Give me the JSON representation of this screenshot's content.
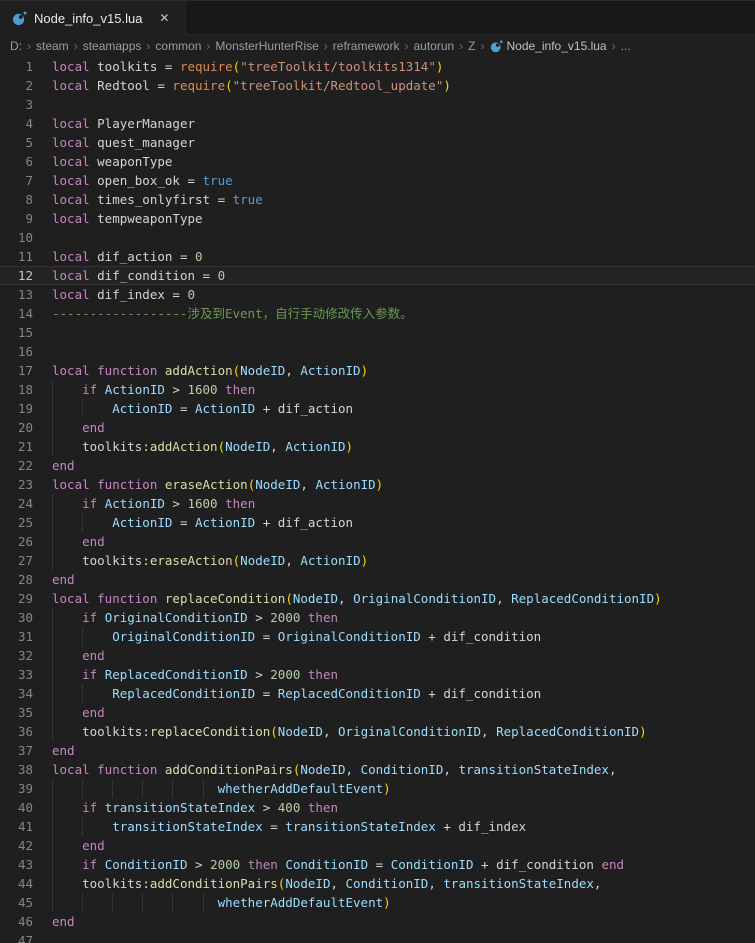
{
  "tab": {
    "title": "Node_info_v15.lua",
    "close_glyph": "✕"
  },
  "breadcrumb": {
    "items": [
      "D:",
      "steam",
      "steamapps",
      "common",
      "MonsterHunterRise",
      "reframework",
      "autorun",
      "Z"
    ],
    "file": "Node_info_v15.lua",
    "trailing": "...",
    "separator": "›"
  },
  "colors": {
    "tokens": {
      "kw": "#C586C0",
      "fn": "#DCDCAA",
      "rq": "#D98C54",
      "v": "#D4D4D4",
      "p": "#9CDCFE",
      "op": "#D4D4D4",
      "b": "#FFD700",
      "s": "#CE9178",
      "n": "#B5CEA8",
      "bo": "#569CD6",
      "cm": "#6A9955"
    },
    "accent_file_icon": "#4d9fd1"
  },
  "editor": {
    "language": "lua",
    "current_line": 12,
    "lines": [
      {
        "n": 1,
        "g": [],
        "t": [
          [
            "kw",
            "local "
          ],
          [
            "v",
            "toolkits"
          ],
          [
            "op",
            " = "
          ],
          [
            "rq",
            "require"
          ],
          [
            "b",
            "("
          ],
          [
            "s",
            "\"treeToolkit/toolkits1314\""
          ],
          [
            "b",
            ")"
          ]
        ]
      },
      {
        "n": 2,
        "g": [],
        "t": [
          [
            "kw",
            "local "
          ],
          [
            "v",
            "Redtool"
          ],
          [
            "op",
            " = "
          ],
          [
            "rq",
            "require"
          ],
          [
            "b",
            "("
          ],
          [
            "s",
            "\"treeToolkit/Redtool_update\""
          ],
          [
            "b",
            ")"
          ]
        ]
      },
      {
        "n": 3,
        "g": [],
        "t": []
      },
      {
        "n": 4,
        "g": [],
        "t": [
          [
            "kw",
            "local "
          ],
          [
            "v",
            "PlayerManager"
          ]
        ]
      },
      {
        "n": 5,
        "g": [],
        "t": [
          [
            "kw",
            "local "
          ],
          [
            "v",
            "quest_manager"
          ]
        ]
      },
      {
        "n": 6,
        "g": [],
        "t": [
          [
            "kw",
            "local "
          ],
          [
            "v",
            "weaponType"
          ]
        ]
      },
      {
        "n": 7,
        "g": [],
        "t": [
          [
            "kw",
            "local "
          ],
          [
            "v",
            "open_box_ok"
          ],
          [
            "op",
            " = "
          ],
          [
            "bo",
            "true"
          ]
        ]
      },
      {
        "n": 8,
        "g": [],
        "t": [
          [
            "kw",
            "local "
          ],
          [
            "v",
            "times_onlyfirst"
          ],
          [
            "op",
            " = "
          ],
          [
            "bo",
            "true"
          ]
        ]
      },
      {
        "n": 9,
        "g": [],
        "t": [
          [
            "kw",
            "local "
          ],
          [
            "v",
            "tempweaponType"
          ]
        ]
      },
      {
        "n": 10,
        "g": [],
        "t": []
      },
      {
        "n": 11,
        "g": [],
        "t": [
          [
            "kw",
            "local "
          ],
          [
            "v",
            "dif_action"
          ],
          [
            "op",
            " = "
          ],
          [
            "n",
            "0"
          ]
        ]
      },
      {
        "n": 12,
        "g": [],
        "t": [
          [
            "kw",
            "local "
          ],
          [
            "v",
            "dif_condition"
          ],
          [
            "op",
            " = "
          ],
          [
            "n",
            "0"
          ]
        ]
      },
      {
        "n": 13,
        "g": [],
        "t": [
          [
            "kw",
            "local "
          ],
          [
            "v",
            "dif_index"
          ],
          [
            "op",
            " = "
          ],
          [
            "n",
            "0"
          ]
        ]
      },
      {
        "n": 14,
        "g": [],
        "t": [
          [
            "cm",
            "------------------涉及到Event，自行手动修改传入参数。"
          ]
        ]
      },
      {
        "n": 15,
        "g": [],
        "t": []
      },
      {
        "n": 16,
        "g": [],
        "t": []
      },
      {
        "n": 17,
        "g": [],
        "t": [
          [
            "kw",
            "local function "
          ],
          [
            "fn",
            "addAction"
          ],
          [
            "b",
            "("
          ],
          [
            "p",
            "NodeID"
          ],
          [
            "op",
            ", "
          ],
          [
            "p",
            "ActionID"
          ],
          [
            "b",
            ")"
          ]
        ]
      },
      {
        "n": 18,
        "g": [
          0
        ],
        "t": [
          [
            "kw",
            "    if "
          ],
          [
            "p",
            "ActionID"
          ],
          [
            "op",
            " > "
          ],
          [
            "n",
            "1600"
          ],
          [
            "kw",
            " then"
          ]
        ]
      },
      {
        "n": 19,
        "g": [
          0,
          4
        ],
        "t": [
          [
            "p",
            "        ActionID"
          ],
          [
            "op",
            " = "
          ],
          [
            "p",
            "ActionID"
          ],
          [
            "op",
            " + "
          ],
          [
            "v",
            "dif_action"
          ]
        ]
      },
      {
        "n": 20,
        "g": [
          0
        ],
        "t": [
          [
            "kw",
            "    end"
          ]
        ]
      },
      {
        "n": 21,
        "g": [
          0
        ],
        "t": [
          [
            "v",
            "    toolkits"
          ],
          [
            "op",
            ":"
          ],
          [
            "fn",
            "addAction"
          ],
          [
            "b",
            "("
          ],
          [
            "p",
            "NodeID"
          ],
          [
            "op",
            ", "
          ],
          [
            "p",
            "ActionID"
          ],
          [
            "b",
            ")"
          ]
        ]
      },
      {
        "n": 22,
        "g": [],
        "t": [
          [
            "kw",
            "end"
          ]
        ]
      },
      {
        "n": 23,
        "g": [],
        "t": [
          [
            "kw",
            "local function "
          ],
          [
            "fn",
            "eraseAction"
          ],
          [
            "b",
            "("
          ],
          [
            "p",
            "NodeID"
          ],
          [
            "op",
            ", "
          ],
          [
            "p",
            "ActionID"
          ],
          [
            "b",
            ")"
          ]
        ]
      },
      {
        "n": 24,
        "g": [
          0
        ],
        "t": [
          [
            "kw",
            "    if "
          ],
          [
            "p",
            "ActionID"
          ],
          [
            "op",
            " > "
          ],
          [
            "n",
            "1600"
          ],
          [
            "kw",
            " then"
          ]
        ]
      },
      {
        "n": 25,
        "g": [
          0,
          4
        ],
        "t": [
          [
            "p",
            "        ActionID"
          ],
          [
            "op",
            " = "
          ],
          [
            "p",
            "ActionID"
          ],
          [
            "op",
            " + "
          ],
          [
            "v",
            "dif_action"
          ]
        ]
      },
      {
        "n": 26,
        "g": [
          0
        ],
        "t": [
          [
            "kw",
            "    end"
          ]
        ]
      },
      {
        "n": 27,
        "g": [
          0
        ],
        "t": [
          [
            "v",
            "    toolkits"
          ],
          [
            "op",
            ":"
          ],
          [
            "fn",
            "eraseAction"
          ],
          [
            "b",
            "("
          ],
          [
            "p",
            "NodeID"
          ],
          [
            "op",
            ", "
          ],
          [
            "p",
            "ActionID"
          ],
          [
            "b",
            ")"
          ]
        ]
      },
      {
        "n": 28,
        "g": [],
        "t": [
          [
            "kw",
            "end"
          ]
        ]
      },
      {
        "n": 29,
        "g": [],
        "t": [
          [
            "kw",
            "local function "
          ],
          [
            "fn",
            "replaceCondition"
          ],
          [
            "b",
            "("
          ],
          [
            "p",
            "NodeID"
          ],
          [
            "op",
            ", "
          ],
          [
            "p",
            "OriginalConditionID"
          ],
          [
            "op",
            ", "
          ],
          [
            "p",
            "ReplacedConditionID"
          ],
          [
            "b",
            ")"
          ]
        ]
      },
      {
        "n": 30,
        "g": [
          0
        ],
        "t": [
          [
            "kw",
            "    if "
          ],
          [
            "p",
            "OriginalConditionID"
          ],
          [
            "op",
            " > "
          ],
          [
            "n",
            "2000"
          ],
          [
            "kw",
            " then"
          ]
        ]
      },
      {
        "n": 31,
        "g": [
          0,
          4
        ],
        "t": [
          [
            "p",
            "        OriginalConditionID"
          ],
          [
            "op",
            " = "
          ],
          [
            "p",
            "OriginalConditionID"
          ],
          [
            "op",
            " + "
          ],
          [
            "v",
            "dif_condition"
          ]
        ]
      },
      {
        "n": 32,
        "g": [
          0
        ],
        "t": [
          [
            "kw",
            "    end"
          ]
        ]
      },
      {
        "n": 33,
        "g": [
          0
        ],
        "t": [
          [
            "kw",
            "    if "
          ],
          [
            "p",
            "ReplacedConditionID"
          ],
          [
            "op",
            " > "
          ],
          [
            "n",
            "2000"
          ],
          [
            "kw",
            " then"
          ]
        ]
      },
      {
        "n": 34,
        "g": [
          0,
          4
        ],
        "t": [
          [
            "p",
            "        ReplacedConditionID"
          ],
          [
            "op",
            " = "
          ],
          [
            "p",
            "ReplacedConditionID"
          ],
          [
            "op",
            " + "
          ],
          [
            "v",
            "dif_condition"
          ]
        ]
      },
      {
        "n": 35,
        "g": [
          0
        ],
        "t": [
          [
            "kw",
            "    end"
          ]
        ]
      },
      {
        "n": 36,
        "g": [
          0
        ],
        "t": [
          [
            "v",
            "    toolkits"
          ],
          [
            "op",
            ":"
          ],
          [
            "fn",
            "replaceCondition"
          ],
          [
            "b",
            "("
          ],
          [
            "p",
            "NodeID"
          ],
          [
            "op",
            ", "
          ],
          [
            "p",
            "OriginalConditionID"
          ],
          [
            "op",
            ", "
          ],
          [
            "p",
            "ReplacedConditionID"
          ],
          [
            "b",
            ")"
          ]
        ]
      },
      {
        "n": 37,
        "g": [],
        "t": [
          [
            "kw",
            "end"
          ]
        ]
      },
      {
        "n": 38,
        "g": [],
        "t": [
          [
            "kw",
            "local function "
          ],
          [
            "fn",
            "addConditionPairs"
          ],
          [
            "b",
            "("
          ],
          [
            "p",
            "NodeID"
          ],
          [
            "op",
            ", "
          ],
          [
            "p",
            "ConditionID"
          ],
          [
            "op",
            ", "
          ],
          [
            "p",
            "transitionStateIndex"
          ],
          [
            "op",
            ","
          ]
        ]
      },
      {
        "n": 39,
        "g": [
          0,
          4,
          8,
          12,
          16,
          20
        ],
        "t": [
          [
            "p",
            "                      whetherAddDefaultEvent"
          ],
          [
            "b",
            ")"
          ]
        ]
      },
      {
        "n": 40,
        "g": [
          0
        ],
        "t": [
          [
            "kw",
            "    if "
          ],
          [
            "p",
            "transitionStateIndex"
          ],
          [
            "op",
            " > "
          ],
          [
            "n",
            "400"
          ],
          [
            "kw",
            " then"
          ]
        ]
      },
      {
        "n": 41,
        "g": [
          0,
          4
        ],
        "t": [
          [
            "p",
            "        transitionStateIndex"
          ],
          [
            "op",
            " = "
          ],
          [
            "p",
            "transitionStateIndex"
          ],
          [
            "op",
            " + "
          ],
          [
            "v",
            "dif_index"
          ]
        ]
      },
      {
        "n": 42,
        "g": [
          0
        ],
        "t": [
          [
            "kw",
            "    end"
          ]
        ]
      },
      {
        "n": 43,
        "g": [
          0
        ],
        "t": [
          [
            "kw",
            "    if "
          ],
          [
            "p",
            "ConditionID"
          ],
          [
            "op",
            " > "
          ],
          [
            "n",
            "2000"
          ],
          [
            "kw",
            " then "
          ],
          [
            "p",
            "ConditionID"
          ],
          [
            "op",
            " = "
          ],
          [
            "p",
            "ConditionID"
          ],
          [
            "op",
            " + "
          ],
          [
            "v",
            "dif_condition"
          ],
          [
            "kw",
            " end"
          ]
        ]
      },
      {
        "n": 44,
        "g": [
          0
        ],
        "t": [
          [
            "v",
            "    toolkits"
          ],
          [
            "op",
            ":"
          ],
          [
            "fn",
            "addConditionPairs"
          ],
          [
            "b",
            "("
          ],
          [
            "p",
            "NodeID"
          ],
          [
            "op",
            ", "
          ],
          [
            "p",
            "ConditionID"
          ],
          [
            "op",
            ", "
          ],
          [
            "p",
            "transitionStateIndex"
          ],
          [
            "op",
            ","
          ]
        ]
      },
      {
        "n": 45,
        "g": [
          0,
          4,
          8,
          12,
          16,
          20
        ],
        "t": [
          [
            "p",
            "                      whetherAddDefaultEvent"
          ],
          [
            "b",
            ")"
          ]
        ]
      },
      {
        "n": 46,
        "g": [],
        "t": [
          [
            "kw",
            "end"
          ]
        ]
      },
      {
        "n": 47,
        "g": [],
        "t": []
      }
    ]
  }
}
